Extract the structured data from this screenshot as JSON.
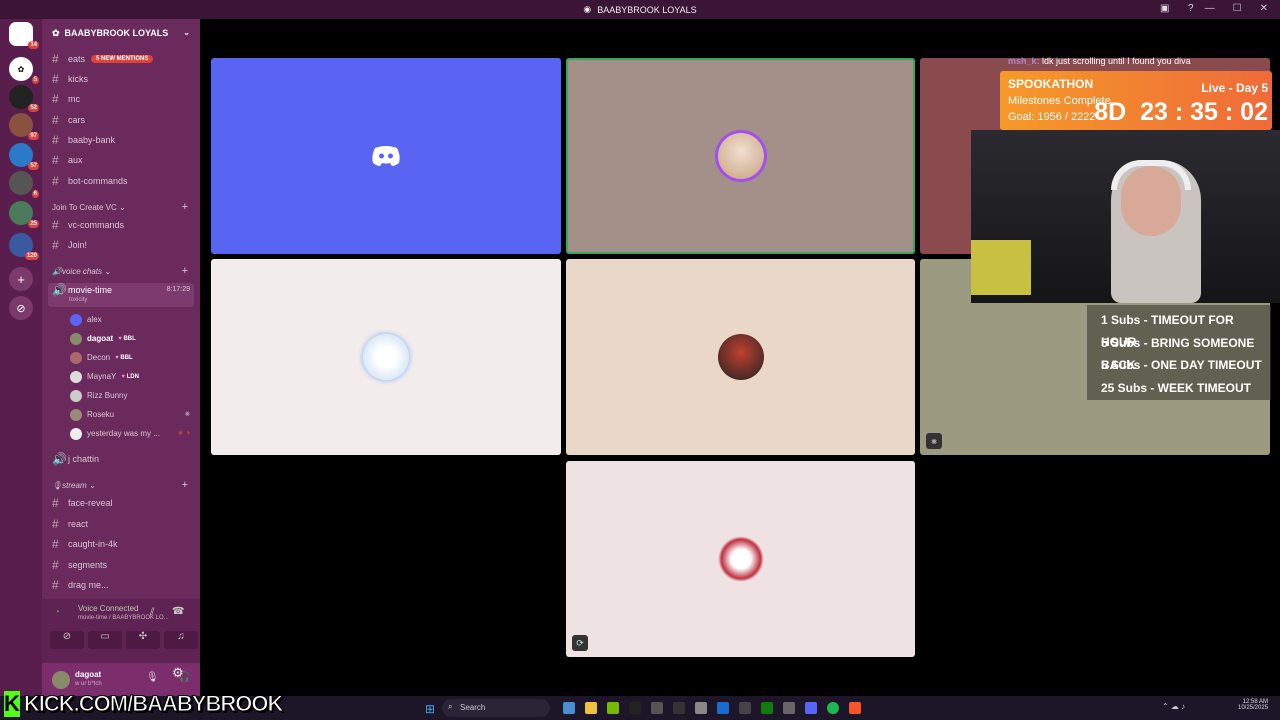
{
  "window": {
    "title": "BAABYBROOK LOYALS"
  },
  "servers": [
    {
      "badge": "14"
    },
    {
      "badge": "5"
    },
    {
      "badge": "52"
    },
    {
      "badge": "97"
    },
    {
      "badge": "57"
    },
    {
      "badge": "6"
    },
    {
      "badge": "25"
    },
    {
      "badge": "120"
    }
  ],
  "sidebar": {
    "server_name": "BAABYBROOK LOYALS",
    "channels_top": [
      "eats",
      "kicks",
      "mc",
      "cars",
      "baaby-bank",
      "aux",
      "bot-commands"
    ],
    "mentions": "5 NEW MENTIONS",
    "category_vc": "Join To Create VC",
    "vc_channels": [
      "vc-commands",
      "Join!"
    ],
    "category_voice": "voice chats",
    "active_voice": {
      "name": "movie-time",
      "sub": "toxicity",
      "timer": "8:17:29"
    },
    "voice_users": [
      {
        "name": "alex",
        "tag": ""
      },
      {
        "name": "dagoat",
        "tag": "BBL"
      },
      {
        "name": "Decon",
        "tag": "BBL"
      },
      {
        "name": "MaynaY",
        "tag": "LDN"
      },
      {
        "name": "Rizz Bunny",
        "tag": ""
      },
      {
        "name": "Roseku",
        "tag": ""
      },
      {
        "name": "yesterday was my ...",
        "tag": ""
      }
    ],
    "other_voice": "j chattin",
    "category_stream": "stream",
    "stream_channels": [
      "face-reveal",
      "react",
      "caught-in-4k",
      "segments",
      "drag me..."
    ],
    "voice_status": "Voice Connected",
    "voice_location": "movie-time / BAABYBROOK LO...",
    "user": {
      "name": "dagoat",
      "status": "w ur b*tch"
    }
  },
  "overlay": {
    "chat_user": "msh_k:",
    "chat_text": "ldk just scrolling until I found you diva",
    "event": "SPOOKATHON",
    "live": "Live - Day 5",
    "milestones": "Milestones Complete",
    "goal": "Goal: 1956 / 2222",
    "timer": "8D  23 : 35 : 02",
    "subs": [
      "1 Subs - TIMEOUT FOR HOUR",
      "5 Subs - BRING SOMEONE BACK",
      "5 Subs - ONE DAY TIMEOUT",
      "25 Subs - WEEK TIMEOUT"
    ],
    "kick_url": "KICK.COM/BAABYBROOK"
  },
  "taskbar": {
    "search": "Search",
    "time": "12:58 AM",
    "date": "10/25/2025"
  },
  "colors": {
    "discord_blurple": "#5865f2",
    "sidebar": "#6a2a5c",
    "rail": "#5a1e4e",
    "kick_green": "#53fc18"
  }
}
